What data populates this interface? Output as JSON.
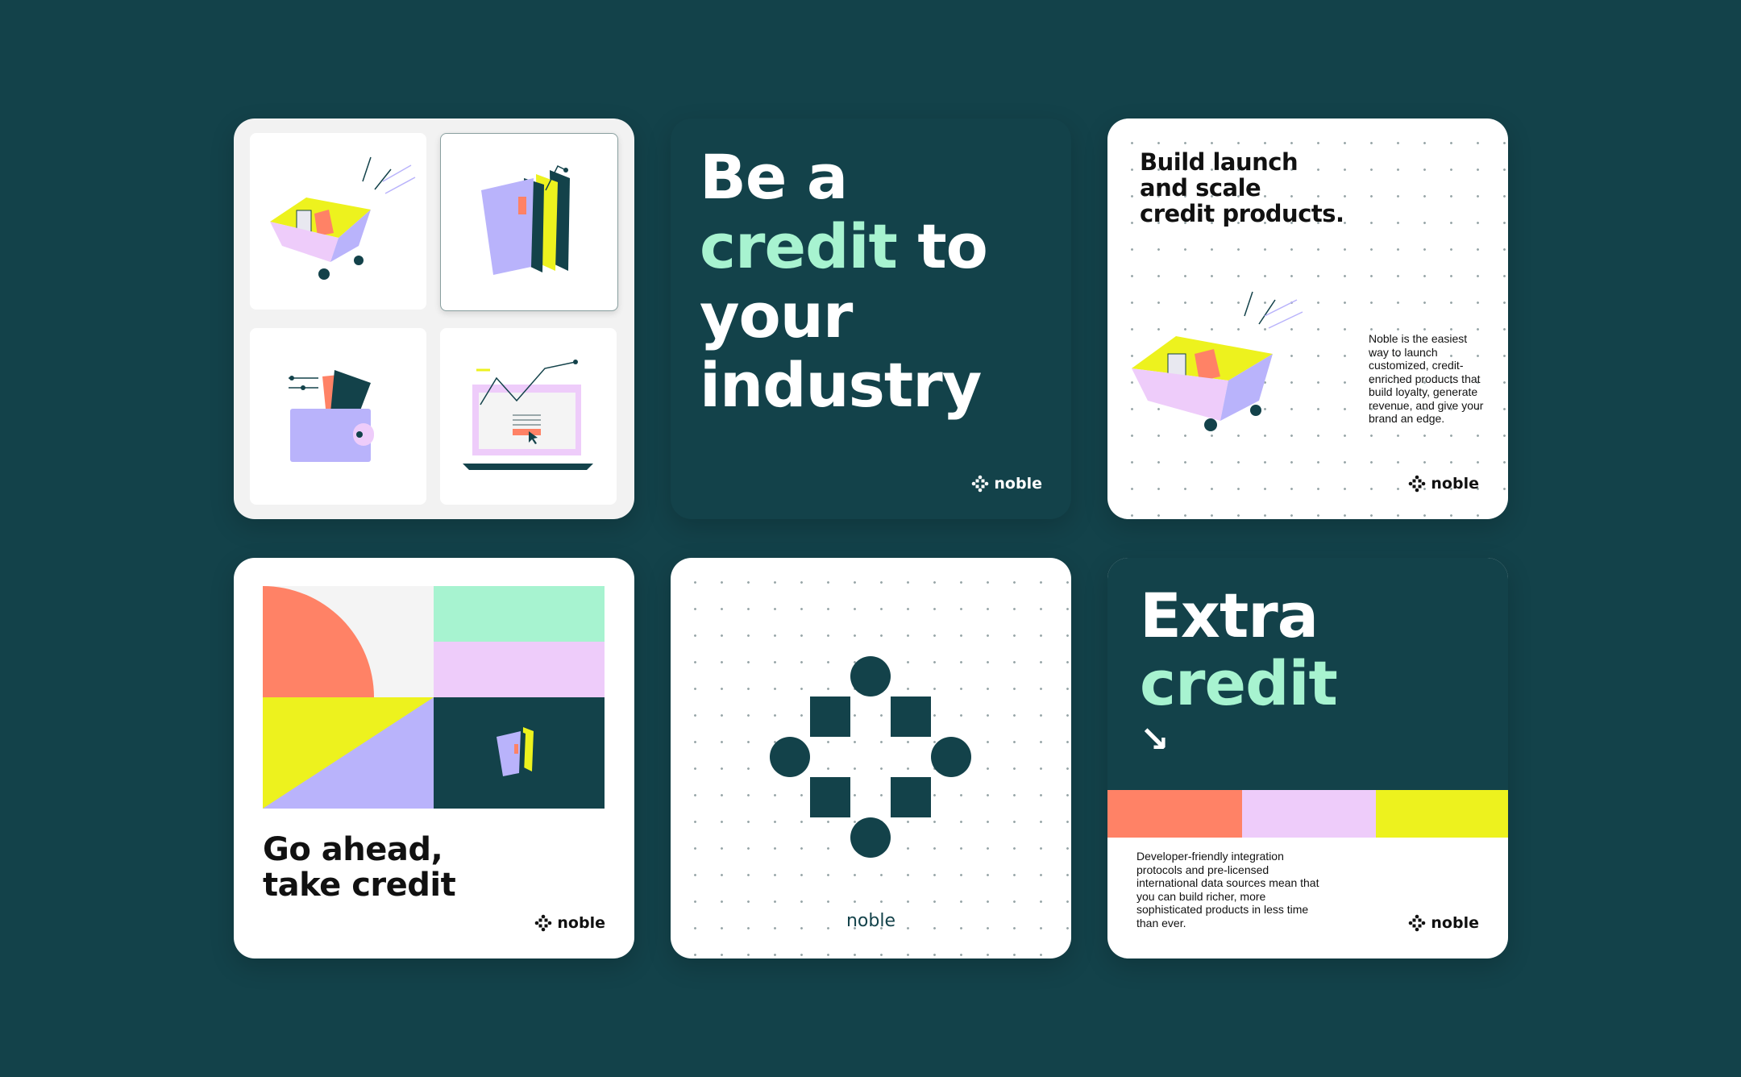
{
  "colors": {
    "background": "#13424a",
    "mint": "#a7f3d0",
    "coral": "#ff8266",
    "lilac": "#eeccfa",
    "lime": "#edf21e",
    "periwinkle": "#b9b3fb",
    "card_white": "#ffffff"
  },
  "brand": {
    "name": "noble"
  },
  "card_illustrations": {
    "tiles": [
      {
        "icon": "shopping-cart-icon"
      },
      {
        "icon": "credit-cards-icon"
      },
      {
        "icon": "wallet-icon"
      },
      {
        "icon": "laptop-chart-icon"
      }
    ]
  },
  "card_headline": {
    "line1": "Be a",
    "line2_accent": "credit",
    "line2_rest": " to",
    "line3": "your",
    "line4": "industry"
  },
  "card_build": {
    "line1": "Build launch",
    "line2": "and scale",
    "line3": "credit products.",
    "body": "Noble is the easiest way to launch customized, credit-enriched products that build loyalty, generate revenue, and give your brand an edge."
  },
  "card_go_ahead": {
    "line1": "Go ahead,",
    "line2": "take credit"
  },
  "card_logo": {
    "wordmark": "noble"
  },
  "card_extra": {
    "line1": "Extra",
    "line2_accent": "credit",
    "arrow": "↘",
    "body": "Developer-friendly integration protocols and pre-licensed international data sources mean that you can build richer, more sophisticated products in less time than ever."
  }
}
